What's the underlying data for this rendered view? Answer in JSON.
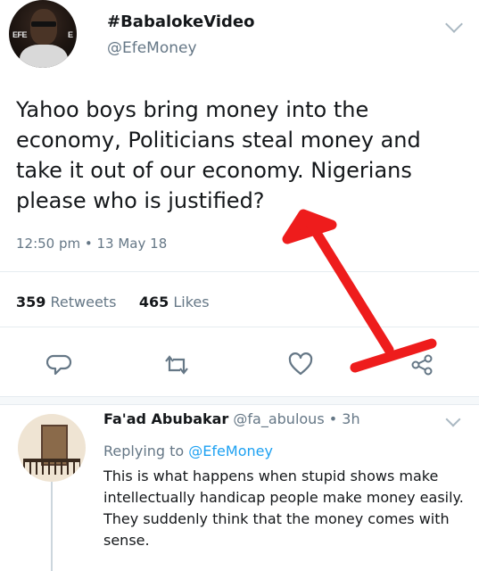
{
  "tweet": {
    "display_name": "#BabalokeVideo",
    "handle": "@EfeMoney",
    "avatar_tag_left": "EFE",
    "avatar_tag_right": "E",
    "text": "Yahoo boys bring money into the economy, Politicians steal money and take it out of our economy. Nigerians please who is justified?",
    "timestamp": "12:50 pm • 13 May 18",
    "retweets_count": "359",
    "retweets_label": "Retweets",
    "likes_count": "465",
    "likes_label": "Likes"
  },
  "actions": {
    "icons": [
      "reply-icon",
      "retweet-icon",
      "like-icon",
      "share-icon"
    ]
  },
  "reply": {
    "display_name": "Fa'ad Abubakar",
    "handle": "@fa_abulous",
    "time": "• 3h",
    "replying_prefix": "Replying to",
    "replying_handle": "@EfeMoney",
    "text": "This is what happens when stupid shows make intellectually handicap people make money easily. They suddenly think that the money comes with sense."
  },
  "colors": {
    "accent": "#1da1f2",
    "secondary_text": "#657786",
    "annotation_arrow": "#ee1c1c"
  }
}
